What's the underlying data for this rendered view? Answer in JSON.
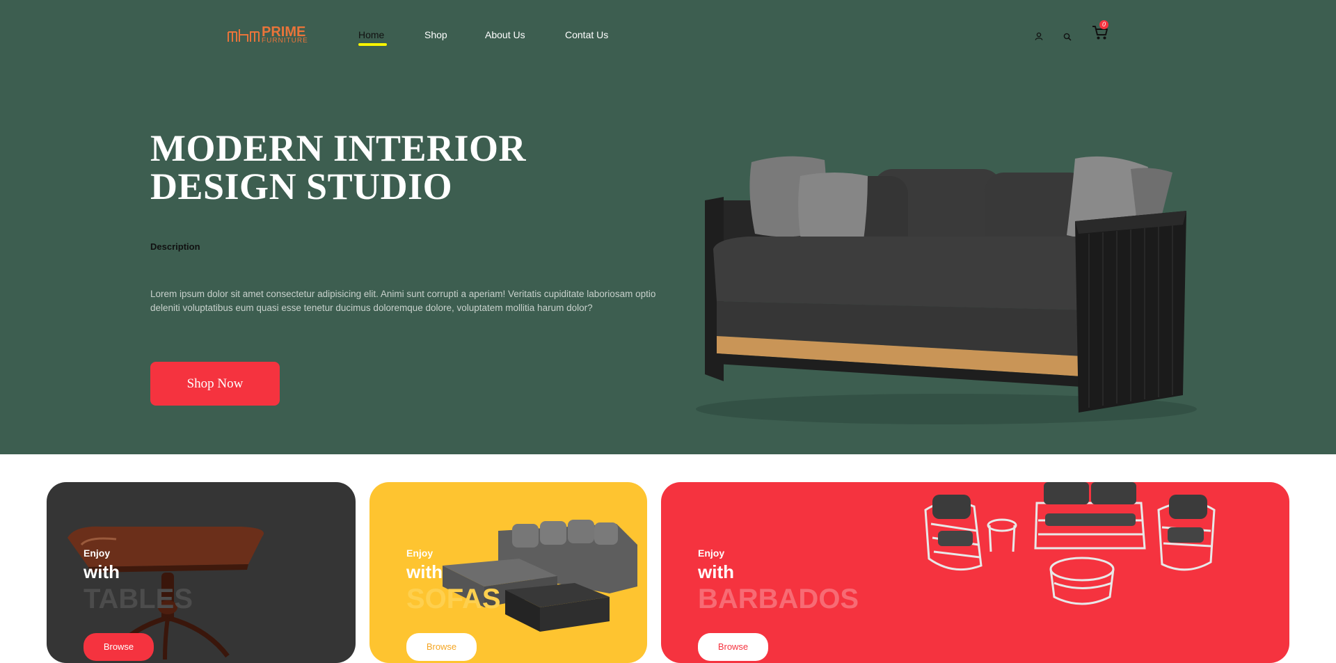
{
  "brand": {
    "name": "PRIME",
    "tagline": "FURNITURE"
  },
  "nav": {
    "items": [
      {
        "label": "Home",
        "active": true
      },
      {
        "label": "Shop",
        "active": false
      },
      {
        "label": "About Us",
        "active": false
      },
      {
        "label": "Contat Us",
        "active": false
      }
    ],
    "icons": [
      "user-icon",
      "search-icon",
      "cart-icon"
    ],
    "cart_count": "0"
  },
  "hero": {
    "title": "MODERN INTERIOR\nDESIGN STUDIO",
    "subtitle": "Description",
    "description": "Lorem ipsum dolor sit amet consectetur adipisicing elit. Animi sunt corrupti a aperiam! Veritatis cupiditate laboriosam optio deleniti voluptatibus eum quasi esse tenetur ducimus doloremque dolore, voluptatem mollitia harum dolor?",
    "cta_label": "Shop Now"
  },
  "categories": [
    {
      "enjoy": "Enjoy",
      "with": "with",
      "name": "TABLES",
      "button": "Browse"
    },
    {
      "enjoy": "Enjoy",
      "with": "with",
      "name": "SOFAS",
      "button": "Browse"
    },
    {
      "enjoy": "Enjoy",
      "with": "with",
      "name": "BARBADOS",
      "button": "Browse"
    }
  ],
  "colors": {
    "hero_bg": "#3d5e50",
    "accent_red": "#f5333f",
    "accent_yellow": "#fec430",
    "dark_card": "#353535",
    "brand_orange": "#e9743a",
    "nav_underline": "#f7f400"
  }
}
